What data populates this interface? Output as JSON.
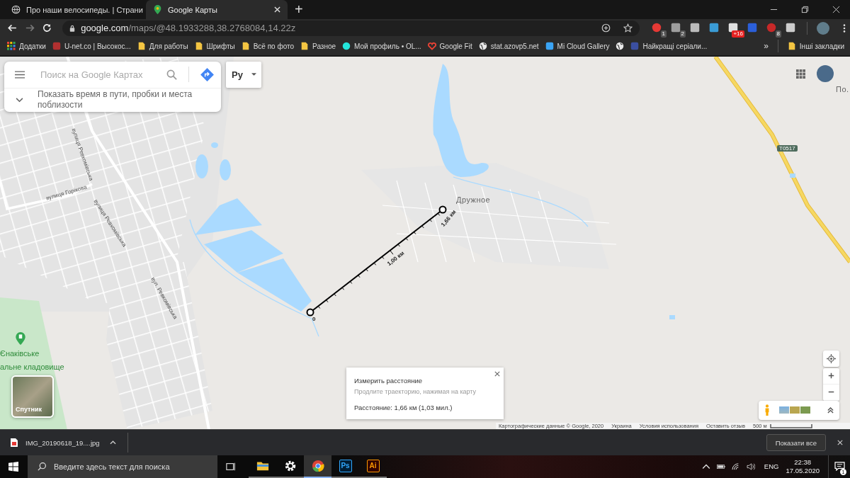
{
  "browser": {
    "tabs": [
      {
        "title": "Про наши велосипеды. | Страни",
        "selected": false
      },
      {
        "title": "Google Карты",
        "selected": true
      }
    ],
    "new_tab": "+",
    "url": {
      "domain": "google.com",
      "path": "/maps/@48.1933288,38.2768084,14.22z"
    },
    "extensions": [
      {
        "kind": "flag",
        "badge": "1"
      },
      {
        "kind": "mail",
        "badge": "2"
      },
      {
        "kind": "font"
      },
      {
        "kind": "camera"
      },
      {
        "kind": "cloud",
        "badge": "+16"
      },
      {
        "kind": "word"
      },
      {
        "kind": "adblock",
        "badge": "8"
      },
      {
        "kind": "windows"
      }
    ],
    "bookmarks": [
      {
        "kind": "apps",
        "label": "Додатки"
      },
      {
        "kind": "site",
        "label": "U-net.co | Высокос..."
      },
      {
        "kind": "folder",
        "label": "Для работы"
      },
      {
        "kind": "folder",
        "label": "Шрифты"
      },
      {
        "kind": "folder",
        "label": "Всё по фото"
      },
      {
        "kind": "folder",
        "label": "Разное"
      },
      {
        "kind": "olx",
        "label": "Мой профиль • OL..."
      },
      {
        "kind": "heart",
        "label": "Google Fit"
      },
      {
        "kind": "globe",
        "label": "stat.azovp5.net"
      },
      {
        "kind": "cloud",
        "label": "Mi Cloud Gallery"
      },
      {
        "kind": "globe"
      },
      {
        "kind": "film",
        "label": "Найкращі серіали..."
      }
    ],
    "more": "»",
    "other_bookmarks": "Інші закладки"
  },
  "map": {
    "search": {
      "placeholder": "Поиск на Google Картах"
    },
    "suggestion": "Показать время в пути, пробки и места поблизости",
    "language": "Ру",
    "labels": [
      {
        "kind": "street",
        "text": "вулиця Ревкомівська"
      },
      {
        "kind": "street",
        "text": "вулиця Горікова"
      },
      {
        "kind": "street",
        "text": "вулиця Ревкомівська"
      },
      {
        "kind": "street",
        "text": "вул. Ревкомівська"
      },
      {
        "kind": "place",
        "text": "Дружное"
      },
      {
        "kind": "place",
        "text": "По."
      },
      {
        "kind": "road",
        "text": "T0517"
      },
      {
        "kind": "park",
        "text": "Єнаківське"
      },
      {
        "kind": "park",
        "text": "альне кладовище"
      }
    ],
    "measure": {
      "start": "0",
      "mid": "1,00 км",
      "end": "1,66 км"
    },
    "layer_label": "Спутник",
    "info": {
      "title": "Измерить расстояние",
      "hint": "Продлите траекторию, нажимая на карту",
      "distance": "Расстояние: 1,66 км (1,03 мил.)"
    },
    "footer": [
      "Картографические данные © Google, 2020",
      "Украина",
      "Условия использования",
      "Оставить отзыв"
    ],
    "scale": "500 м"
  },
  "download_bar": {
    "file": "IMG_20190618_19....jpg",
    "show_all": "Показати все"
  },
  "taskbar": {
    "search_placeholder": "Введите здесь текст для поиска",
    "apps": [
      {
        "kind": "explorer",
        "selected": false
      },
      {
        "kind": "settings",
        "selected": false
      },
      {
        "kind": "chrome",
        "selected": true
      },
      {
        "kind": "ps",
        "text": "Ps",
        "selected": false
      },
      {
        "kind": "ai",
        "text": "Ai",
        "selected": false
      }
    ],
    "language": "ENG",
    "time": "22:38",
    "date": "17.05.2020",
    "notifications": "1"
  }
}
